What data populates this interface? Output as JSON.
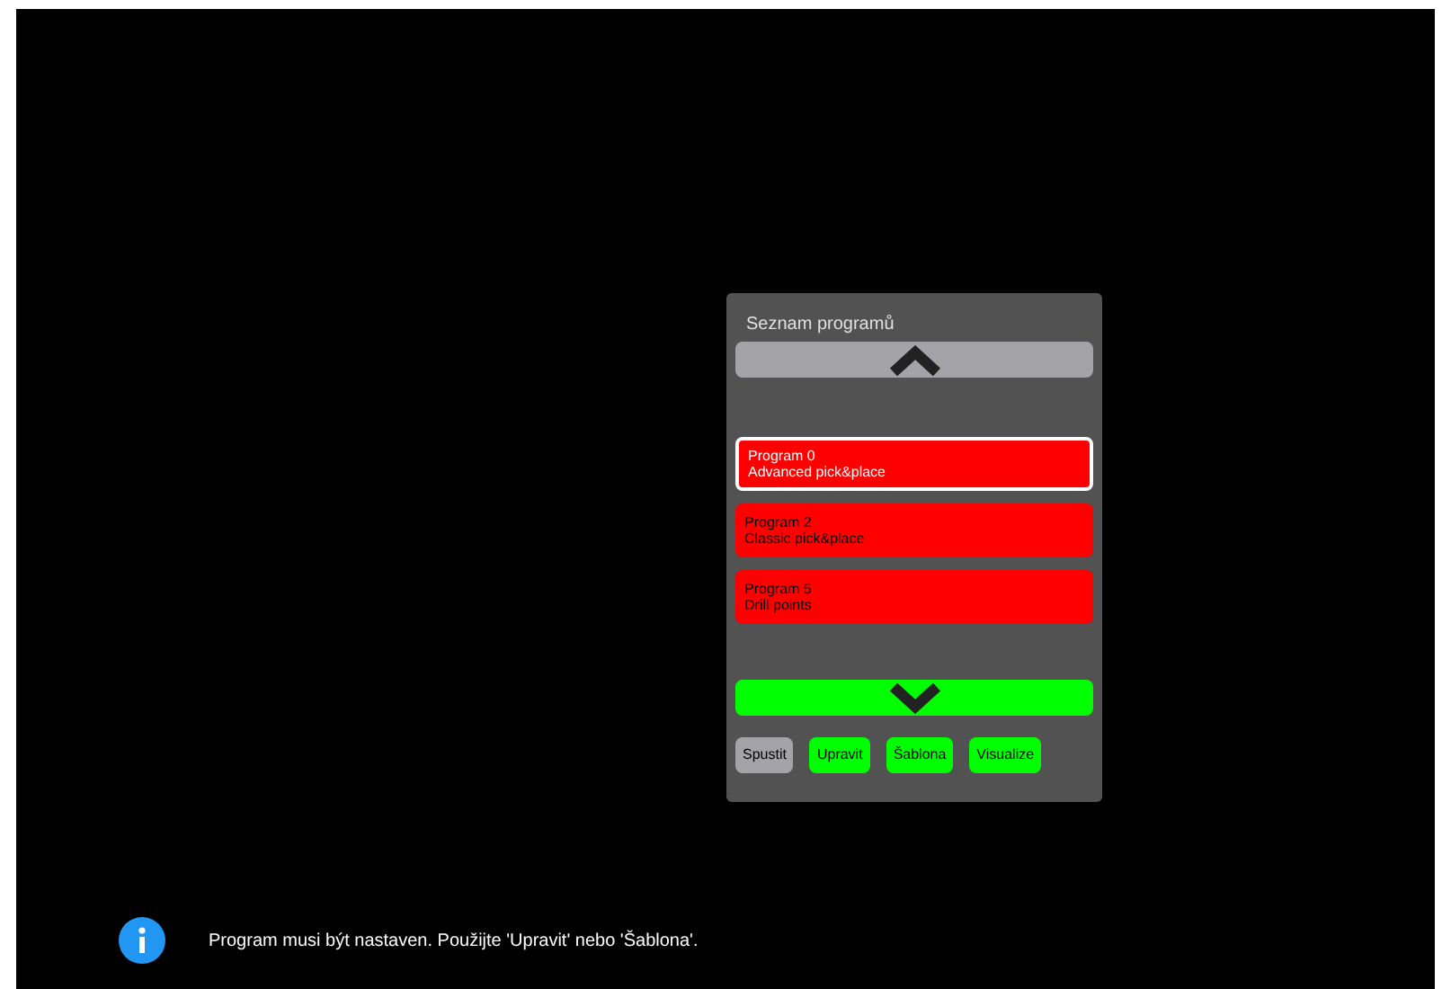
{
  "panel": {
    "title": "Seznam programů",
    "scroll_up": {
      "disabled": true
    },
    "programs": [
      {
        "name": "Program 0",
        "description": "Advanced pick&place",
        "selected": true
      },
      {
        "name": "Program 2",
        "description": "Classic pick&place",
        "selected": false
      },
      {
        "name": "Program 5",
        "description": "Drill points",
        "selected": false
      }
    ],
    "scroll_down": {
      "disabled": false
    },
    "buttons": [
      {
        "label": "Spustit",
        "disabled": true
      },
      {
        "label": "Upravit",
        "disabled": false
      },
      {
        "label": "Šablona",
        "disabled": false
      },
      {
        "label": "Visualize",
        "disabled": false
      }
    ]
  },
  "notification": {
    "text": "Program musi být nastaven. Použijte 'Upravit' nebo 'Šablona'."
  }
}
